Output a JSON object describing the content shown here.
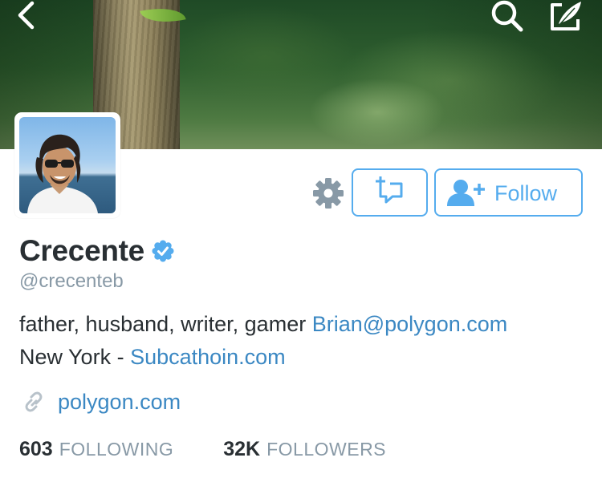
{
  "header": {
    "icons": {
      "back": "chevron-left-icon",
      "search": "search-icon",
      "compose": "compose-icon"
    },
    "icon_color": "#ffffff"
  },
  "profile": {
    "name": "Crecente",
    "verified": true,
    "handle": "@crecenteb",
    "bio": {
      "line1_text": "father, husband, writer, gamer ",
      "line1_link": "Brian@polygon.com",
      "line2_text": "New York - ",
      "line2_link": "Subcathoin.com"
    },
    "website": "polygon.com"
  },
  "actions": {
    "settings_icon": "gear-icon",
    "message_icon": "message-plus-icon",
    "follow_icon": "add-user-icon",
    "follow_label": "Follow"
  },
  "stats": {
    "following_count": "603",
    "following_label": "FOLLOWING",
    "followers_count": "32K",
    "followers_label": "FOLLOWERS"
  },
  "colors": {
    "accent": "#55acee",
    "link": "#3b88c3",
    "text": "#292f33",
    "muted": "#8899a6",
    "gear": "#8899a6",
    "verified": "#55acee"
  }
}
